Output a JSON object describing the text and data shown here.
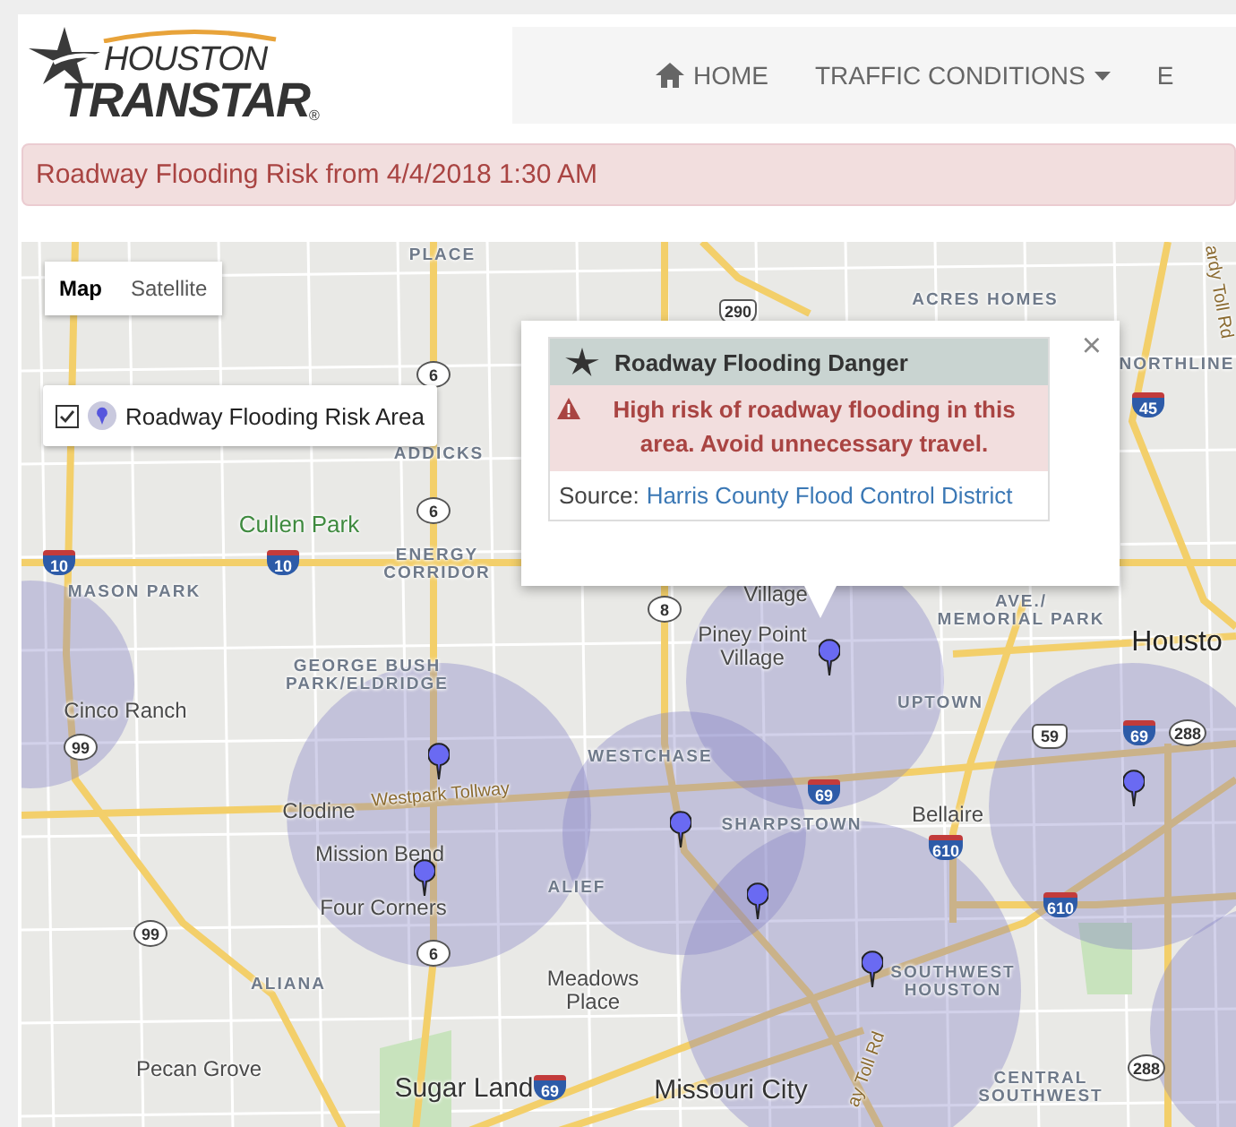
{
  "logo": {
    "line1": "HOUSTON",
    "line2": "TRANSTAR",
    "mark": "®"
  },
  "nav": [
    {
      "label": "HOME",
      "kind": "home"
    },
    {
      "label": "TRAFFIC CONDITIONS",
      "kind": "dropdown"
    },
    {
      "label": "E",
      "kind": "plain"
    }
  ],
  "alert": "Roadway Flooding Risk from 4/4/2018 1:30 AM",
  "map": {
    "type_buttons": [
      {
        "label": "Map",
        "selected": true
      },
      {
        "label": "Satellite",
        "selected": false
      }
    ],
    "legend": {
      "label": "Roadway Flooding Risk Area",
      "checked": true
    },
    "popup": {
      "title": "Roadway Flooding Danger",
      "warning": "High risk of roadway flooding in this area. Avoid unnecessary travel.",
      "source_label": "Source:",
      "source_link": "Harris County Flood Control District",
      "close": "×"
    },
    "labels": [
      {
        "lines": [
          "PLACE"
        ],
        "kind": "district"
      },
      {
        "lines": [
          "ACRES HOMES"
        ],
        "kind": "district"
      },
      {
        "lines": [
          "NORTHLINE"
        ],
        "kind": "district"
      },
      {
        "lines": [
          "ardy Toll Rd"
        ],
        "kind": "road"
      },
      {
        "lines": [
          "ADDICKS"
        ],
        "kind": "district"
      },
      {
        "lines": [
          "Cullen Park"
        ],
        "kind": "park"
      },
      {
        "lines": [
          "ENERGY",
          "CORRIDOR"
        ],
        "kind": "district"
      },
      {
        "lines": [
          "MASON PARK"
        ],
        "kind": "district"
      },
      {
        "lines": [
          "GEORGE BUSH",
          "PARK/ELDRIDGE"
        ],
        "kind": "district"
      },
      {
        "lines": [
          "Cinco Ranch"
        ],
        "kind": "place"
      },
      {
        "lines": [
          "Village"
        ],
        "kind": "place"
      },
      {
        "lines": [
          "Piney Point",
          "Village"
        ],
        "kind": "place"
      },
      {
        "lines": [
          "AVE./",
          "MEMORIAL PARK"
        ],
        "kind": "district"
      },
      {
        "lines": [
          "Housto"
        ],
        "kind": "city"
      },
      {
        "lines": [
          "UPTOWN"
        ],
        "kind": "district"
      },
      {
        "lines": [
          "WESTCHASE"
        ],
        "kind": "district"
      },
      {
        "lines": [
          "Westpark Tollway"
        ],
        "kind": "road"
      },
      {
        "lines": [
          "Clodine"
        ],
        "kind": "place"
      },
      {
        "lines": [
          "SHARPSTOWN"
        ],
        "kind": "district"
      },
      {
        "lines": [
          "Bellaire"
        ],
        "kind": "place"
      },
      {
        "lines": [
          "Mission Bend"
        ],
        "kind": "place"
      },
      {
        "lines": [
          "ALIEF"
        ],
        "kind": "district"
      },
      {
        "lines": [
          "Four Corners"
        ],
        "kind": "place"
      },
      {
        "lines": [
          "ALIANA"
        ],
        "kind": "district"
      },
      {
        "lines": [
          "Meadows",
          "Place"
        ],
        "kind": "place"
      },
      {
        "lines": [
          "SOUTHWEST",
          "HOUSTON"
        ],
        "kind": "district"
      },
      {
        "lines": [
          "Pecan Grove"
        ],
        "kind": "place"
      },
      {
        "lines": [
          "Sugar Land"
        ],
        "kind": "town"
      },
      {
        "lines": [
          "Missouri City"
        ],
        "kind": "town"
      },
      {
        "lines": [
          "CENTRAL",
          "SOUTHWEST"
        ],
        "kind": "district"
      },
      {
        "lines": [
          "ay Toll Rd"
        ],
        "kind": "road"
      }
    ],
    "shields": [
      {
        "label": "6",
        "kind": "state"
      },
      {
        "label": "6",
        "kind": "state"
      },
      {
        "label": "6",
        "kind": "state"
      },
      {
        "label": "10",
        "kind": "interstate"
      },
      {
        "label": "10",
        "kind": "interstate"
      },
      {
        "label": "8",
        "kind": "state"
      },
      {
        "label": "290",
        "kind": "us"
      },
      {
        "label": "45",
        "kind": "interstate"
      },
      {
        "label": "59",
        "kind": "us"
      },
      {
        "label": "69",
        "kind": "interstate"
      },
      {
        "label": "69",
        "kind": "interstate"
      },
      {
        "label": "69",
        "kind": "interstate"
      },
      {
        "label": "288",
        "kind": "state"
      },
      {
        "label": "288",
        "kind": "state"
      },
      {
        "label": "610",
        "kind": "interstate"
      },
      {
        "label": "610",
        "kind": "interstate"
      },
      {
        "label": "99",
        "kind": "state"
      },
      {
        "label": "99",
        "kind": "state"
      }
    ]
  }
}
